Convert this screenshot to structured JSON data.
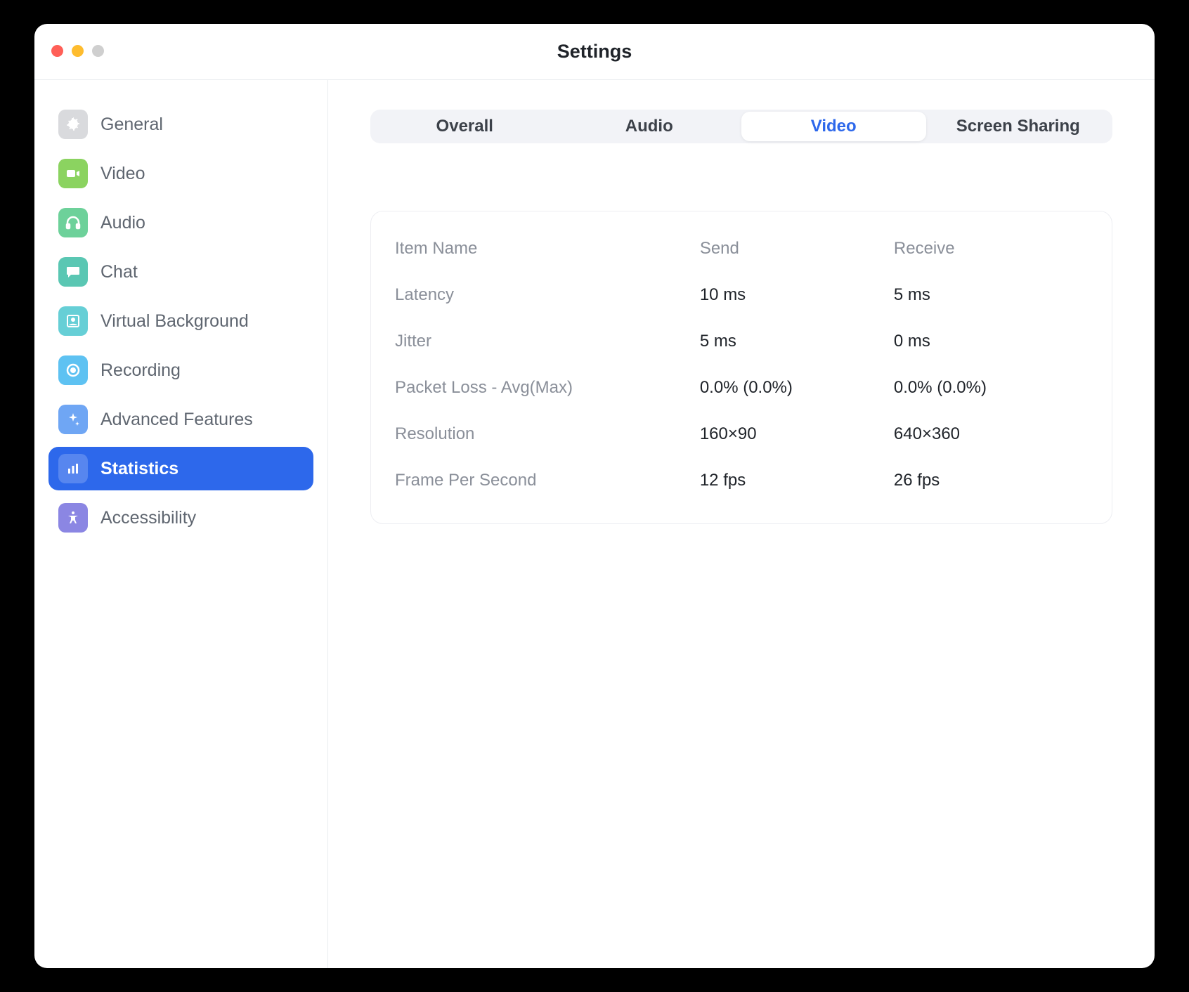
{
  "window": {
    "title": "Settings"
  },
  "sidebar": {
    "items": [
      {
        "id": "general",
        "label": "General"
      },
      {
        "id": "video",
        "label": "Video"
      },
      {
        "id": "audio",
        "label": "Audio"
      },
      {
        "id": "chat",
        "label": "Chat"
      },
      {
        "id": "vbg",
        "label": "Virtual Background"
      },
      {
        "id": "rec",
        "label": "Recording"
      },
      {
        "id": "adv",
        "label": "Advanced Features"
      },
      {
        "id": "stats",
        "label": "Statistics",
        "active": true
      },
      {
        "id": "access",
        "label": "Accessibility"
      }
    ]
  },
  "tabs": {
    "items": [
      {
        "id": "overall",
        "label": "Overall"
      },
      {
        "id": "audio",
        "label": "Audio"
      },
      {
        "id": "video",
        "label": "Video",
        "active": true
      },
      {
        "id": "screen",
        "label": "Screen Sharing"
      }
    ]
  },
  "stats": {
    "headers": {
      "name": "Item Name",
      "send": "Send",
      "recv": "Receive"
    },
    "rows": [
      {
        "name": "Latency",
        "send": "10 ms",
        "recv": "5 ms"
      },
      {
        "name": "Jitter",
        "send": "5 ms",
        "recv": "0 ms"
      },
      {
        "name": "Packet Loss - Avg(Max)",
        "send": "0.0% (0.0%)",
        "recv": "0.0% (0.0%)"
      },
      {
        "name": "Resolution",
        "send": "160×90",
        "recv": "640×360"
      },
      {
        "name": "Frame Per Second",
        "send": "12 fps",
        "recv": "26 fps"
      }
    ]
  }
}
